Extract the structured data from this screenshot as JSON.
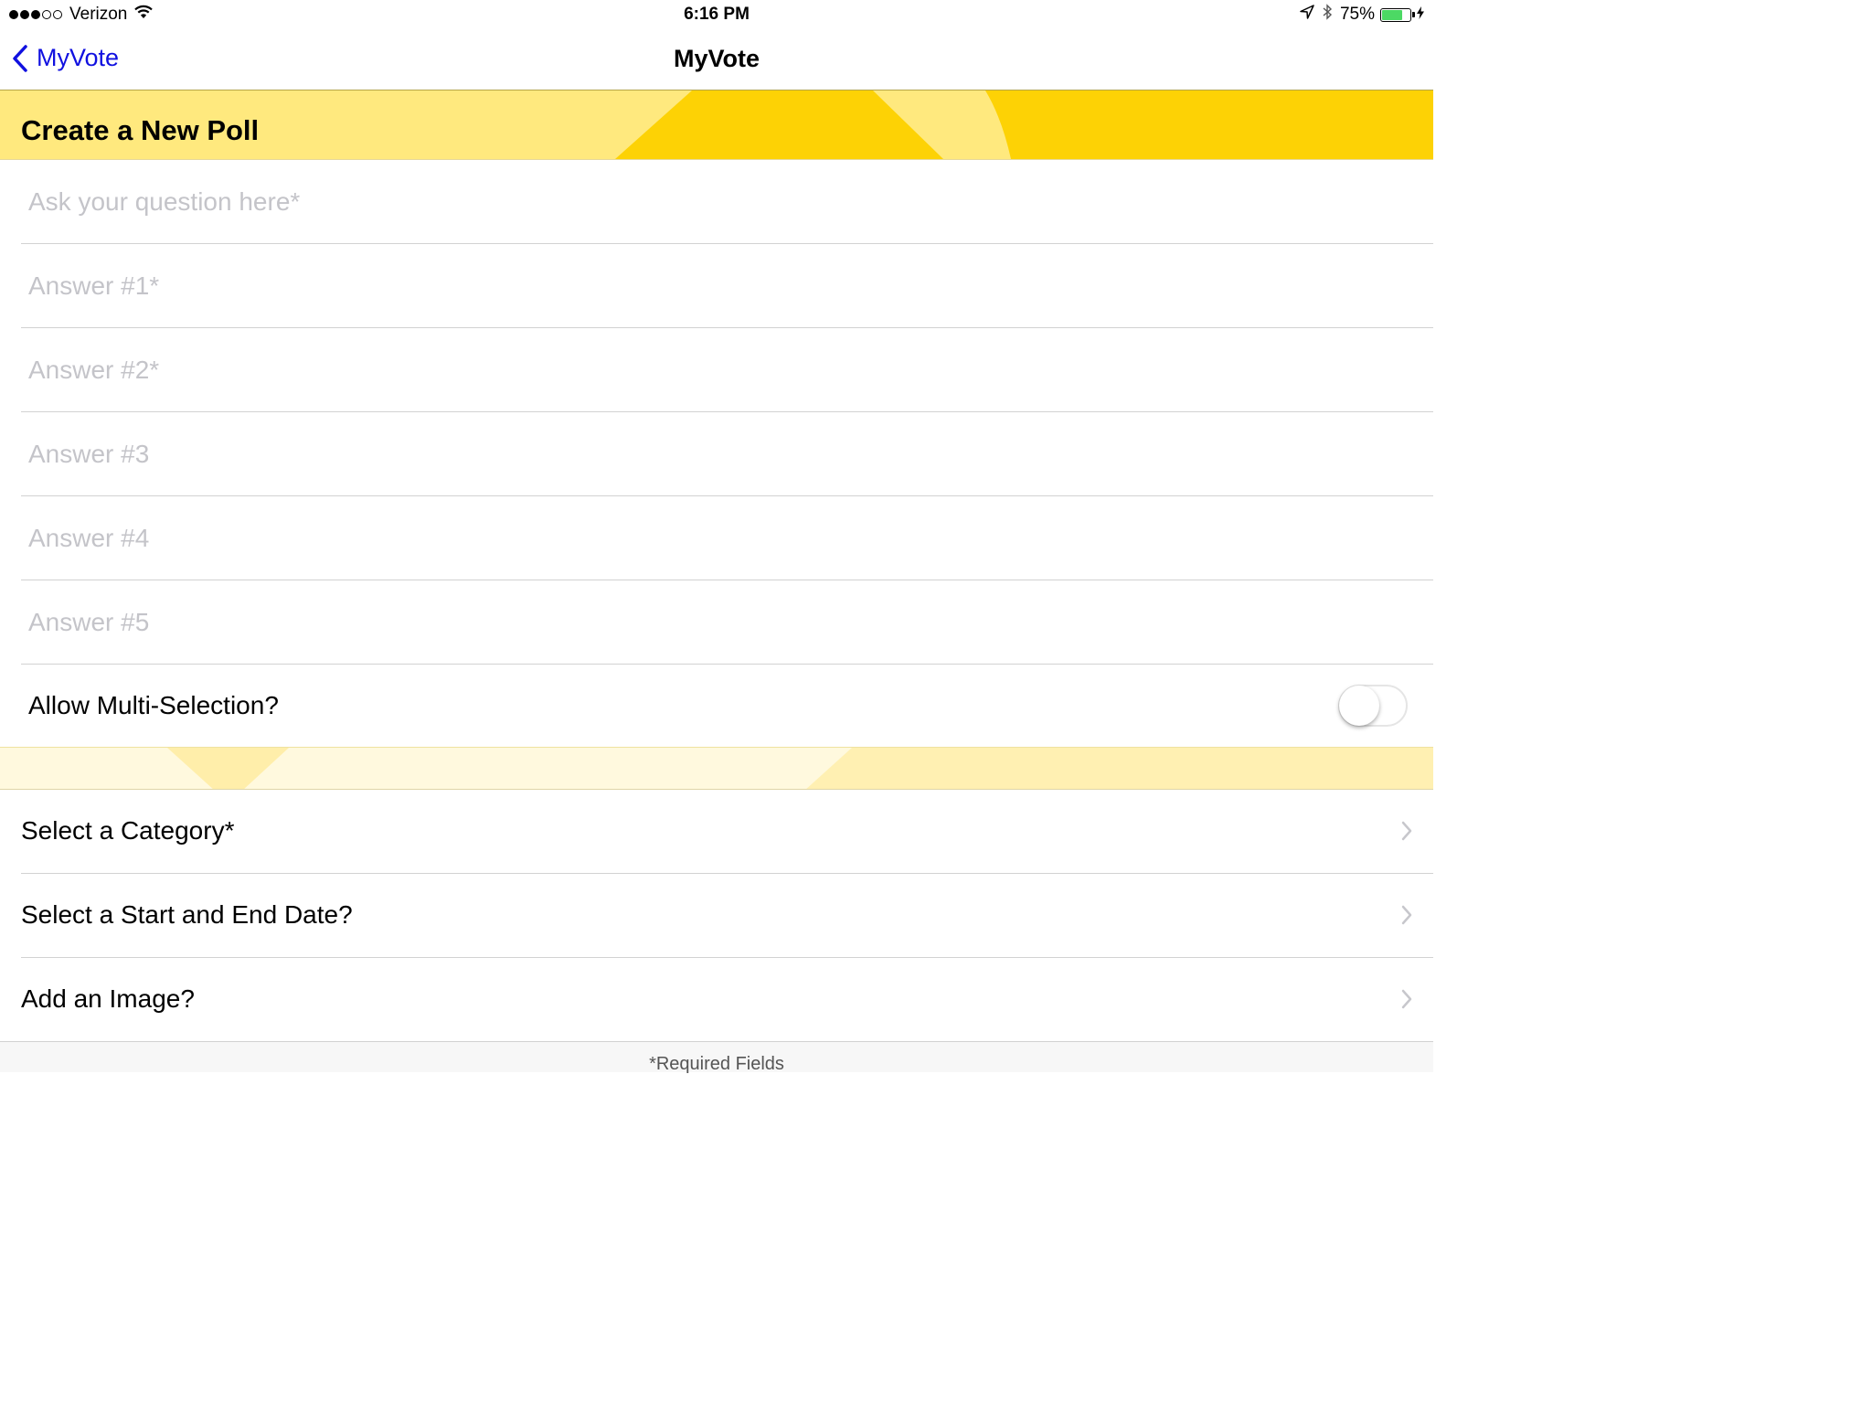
{
  "status_bar": {
    "signal_dots_filled": 3,
    "signal_dots_total": 5,
    "carrier": "Verizon",
    "time": "6:16 PM",
    "battery_percent_label": "75%",
    "battery_level": 0.75,
    "battery_color": "#4cd964",
    "icons": [
      "wifi-icon",
      "location-arrow-icon",
      "bluetooth-icon",
      "battery-icon",
      "charging-bolt-icon"
    ]
  },
  "nav": {
    "back_label": "MyVote",
    "title": "MyVote",
    "accent_color": "#1010e0"
  },
  "header": {
    "title": "Create a New Poll",
    "colors": {
      "light_yellow": "#ffe97e",
      "dark_yellow": "#fdd205"
    }
  },
  "form": {
    "question_placeholder": "Ask your question here*",
    "answers": [
      {
        "placeholder": "Answer #1*",
        "value": ""
      },
      {
        "placeholder": "Answer #2*",
        "value": ""
      },
      {
        "placeholder": "Answer #3",
        "value": ""
      },
      {
        "placeholder": "Answer #4",
        "value": ""
      },
      {
        "placeholder": "Answer #5",
        "value": ""
      }
    ],
    "multi_selection_label": "Allow Multi-Selection?",
    "multi_selection_enabled": false
  },
  "options": [
    {
      "label": "Select a Category*"
    },
    {
      "label": "Select a Start and End Date?"
    },
    {
      "label": "Add an Image?"
    }
  ],
  "footer": {
    "note": "*Required Fields"
  }
}
